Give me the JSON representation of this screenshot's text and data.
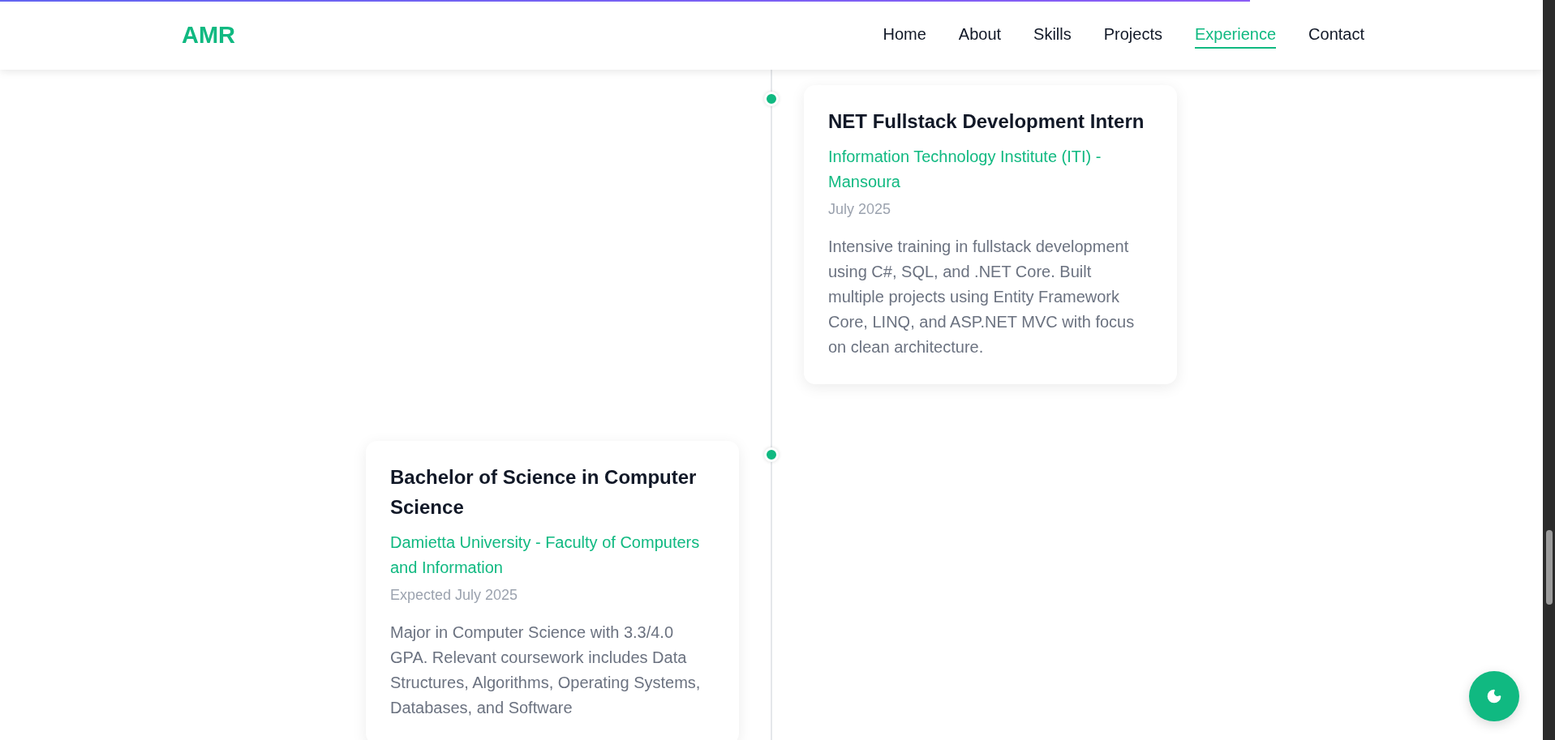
{
  "scroll_progress": {
    "level": 0.81
  },
  "header": {
    "logo": "AMR",
    "nav": [
      {
        "label": "Home",
        "selected": false
      },
      {
        "label": "About",
        "selected": false
      },
      {
        "label": "Skills",
        "selected": false
      },
      {
        "label": "Projects",
        "selected": false
      },
      {
        "label": "Experience",
        "selected": true
      },
      {
        "label": "Contact",
        "selected": false
      }
    ]
  },
  "timeline": [
    {
      "kind": "right",
      "title": "NET Fullstack Development Intern",
      "organization": "Information Technology Institute (ITI) - Mansoura",
      "date": "July 2025",
      "description": "Intensive training in fullstack development using C#, SQL, and .NET Core. Built multiple projects using Entity Framework Core, LINQ, and ASP.NET MVC with focus on clean architecture."
    },
    {
      "kind": "left",
      "title": "Bachelor of Science in Computer Science",
      "organization": "Damietta University - Faculty of Computers and Information",
      "date": "Expected July 2025",
      "description": "Major in Computer Science with 3.3/4.0 GPA. Relevant coursework includes Data Structures, Algorithms, Operating Systems, Databases, and Software"
    }
  ]
}
